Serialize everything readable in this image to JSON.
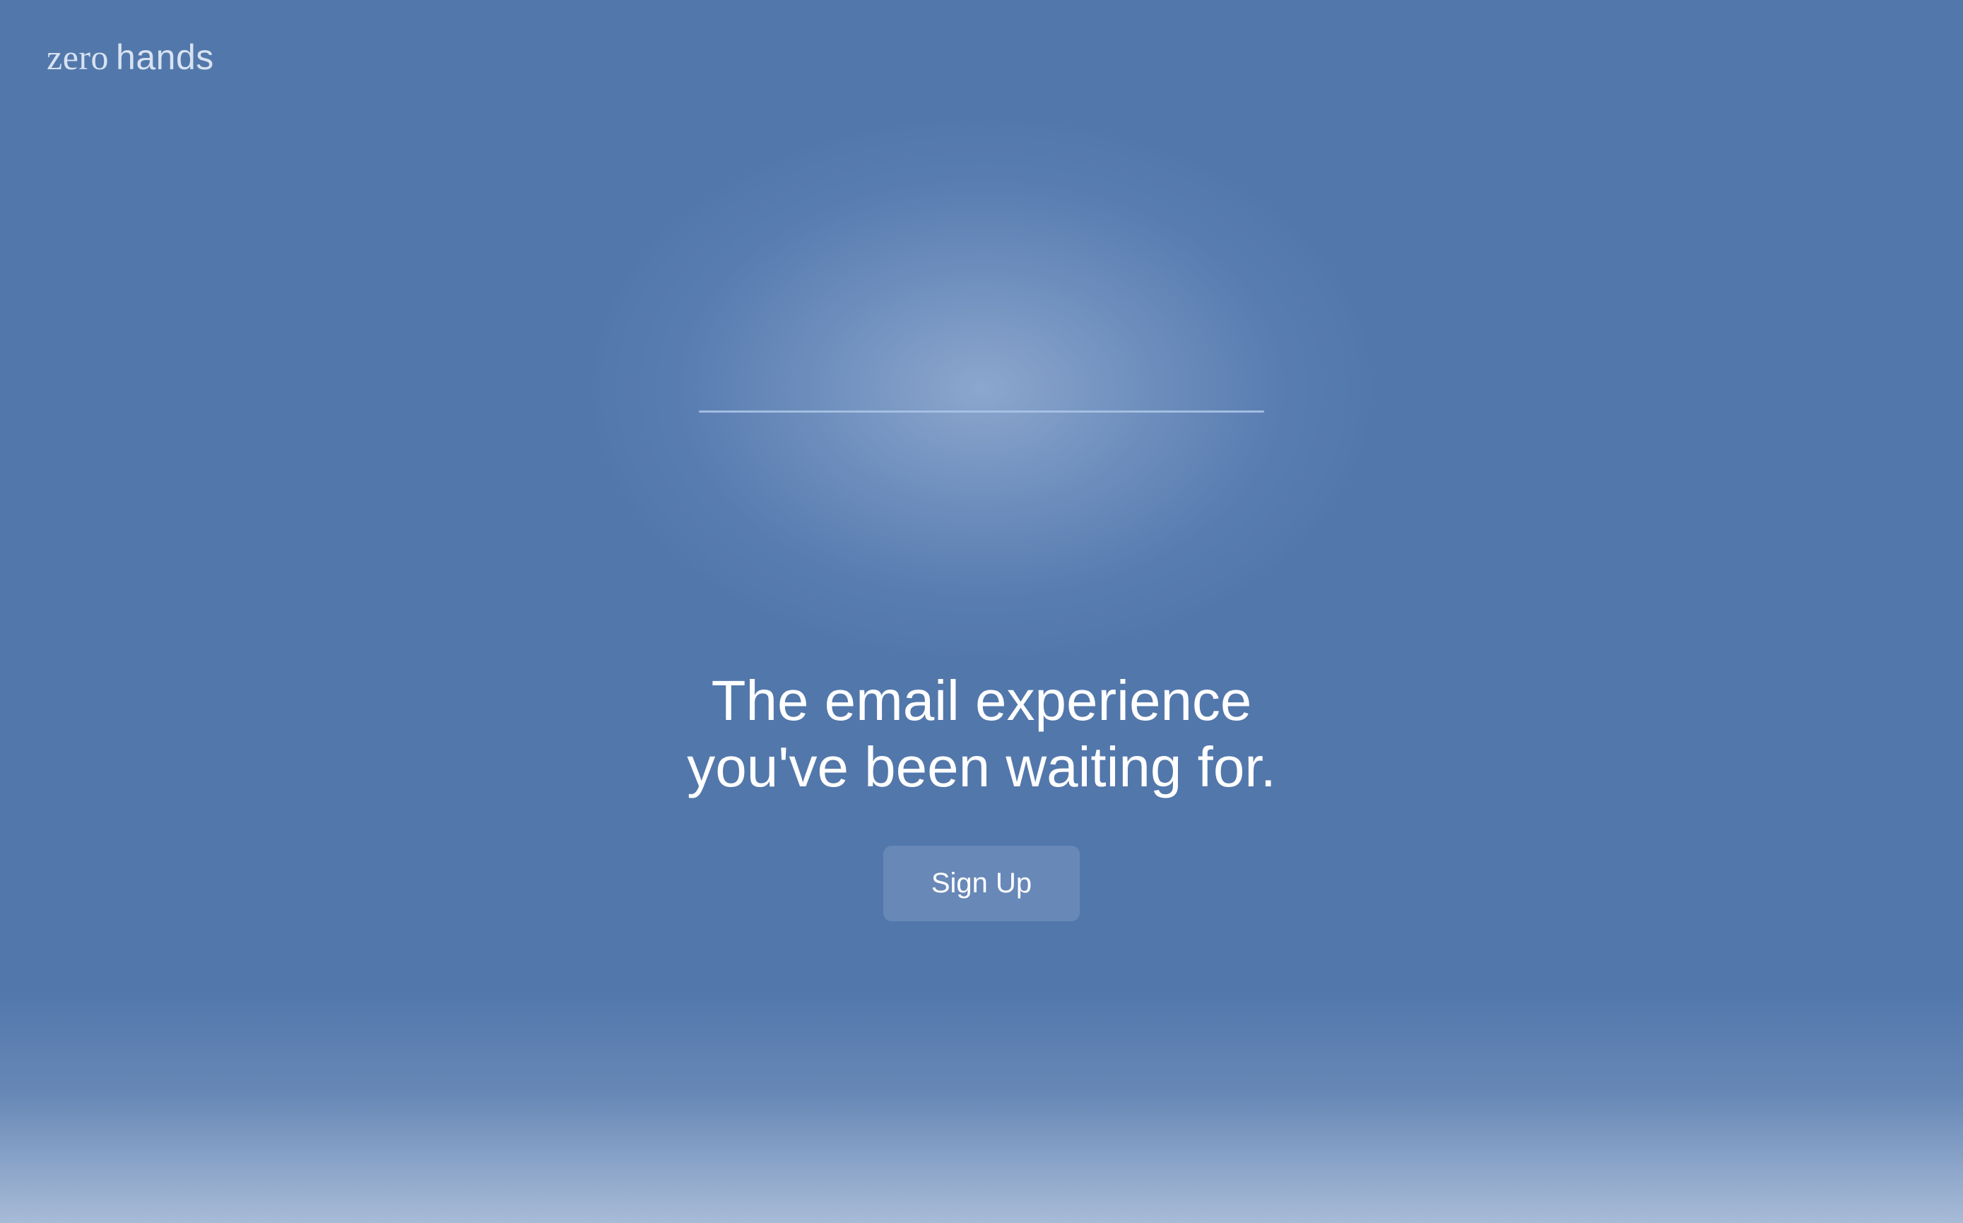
{
  "brand": {
    "logo_word_1": "zero",
    "logo_word_2": "hands"
  },
  "hero": {
    "headline_line_1": "The email experience",
    "headline_line_2": "you've been waiting for."
  },
  "cta": {
    "signup_label": "Sign Up"
  },
  "colors": {
    "background": "#5277ab",
    "logo_text": "#d8e2f1",
    "headline_text": "#ffffff",
    "button_text": "#ffffff"
  }
}
